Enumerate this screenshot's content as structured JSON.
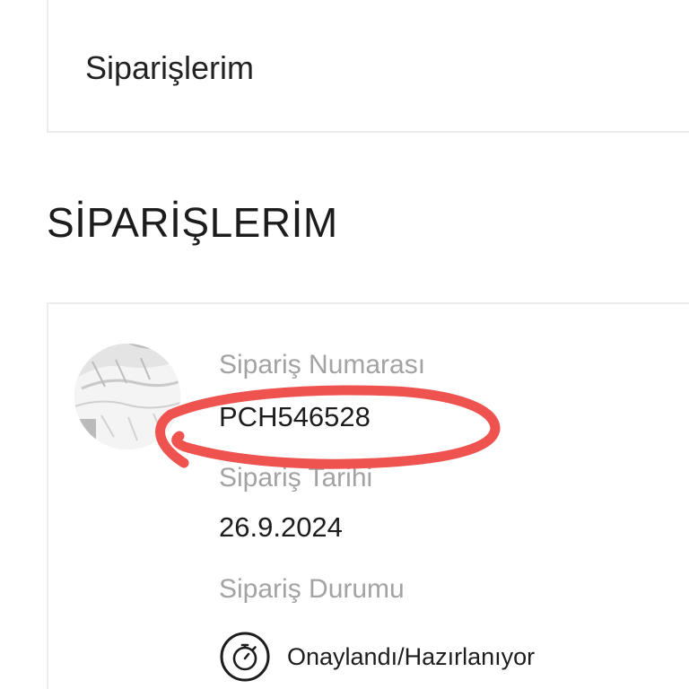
{
  "top_card": {
    "title": "Siparişlerim"
  },
  "page": {
    "heading": "SİPARİŞLERİM"
  },
  "order": {
    "number_label": "Sipariş Numarası",
    "number_value": "PCH546528",
    "date_label": "Sipariş Tarihi",
    "date_value": "26.9.2024",
    "status_label": "Sipariş Durumu",
    "status_value": "Onaylandı/Hazırlanıyor",
    "status_icon": "stopwatch-icon",
    "thumbnail": "product-thumbnail"
  },
  "annotation": {
    "type": "hand-drawn-circle",
    "color": "#ef5350"
  }
}
